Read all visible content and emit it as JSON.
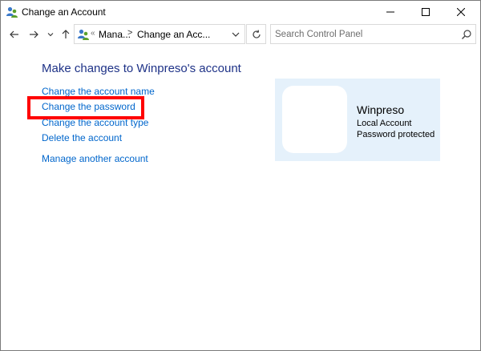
{
  "window": {
    "title": "Change an Account",
    "icon": "user-accounts-icon"
  },
  "titlebar_buttons": {
    "minimize_icon": "minimize-icon",
    "maximize_icon": "maximize-icon",
    "close_icon": "close-icon"
  },
  "navigation": {
    "back_icon": "arrow-left-icon",
    "forward_icon": "arrow-right-icon",
    "recent_icon": "chevron-down-icon",
    "up_icon": "arrow-up-icon",
    "refresh_icon": "refresh-icon"
  },
  "address": {
    "overflow_marker": "«",
    "crumbs": [
      "Mana...",
      "Change an Acc..."
    ],
    "separator": ">"
  },
  "search": {
    "placeholder": "Search Control Panel",
    "value": ""
  },
  "main": {
    "heading": "Make changes to Winpreso's account",
    "links": [
      "Change the account name",
      "Change the password",
      "Change the account type",
      "Delete the account",
      "Manage another account"
    ],
    "highlighted_link_index": 1,
    "highlight_color": "#ff0000",
    "link_color": "#0066cc",
    "heading_color": "#1e3287"
  },
  "account": {
    "name": "Winpreso",
    "type": "Local Account",
    "status": "Password protected",
    "card_color": "#e5f1fb"
  }
}
